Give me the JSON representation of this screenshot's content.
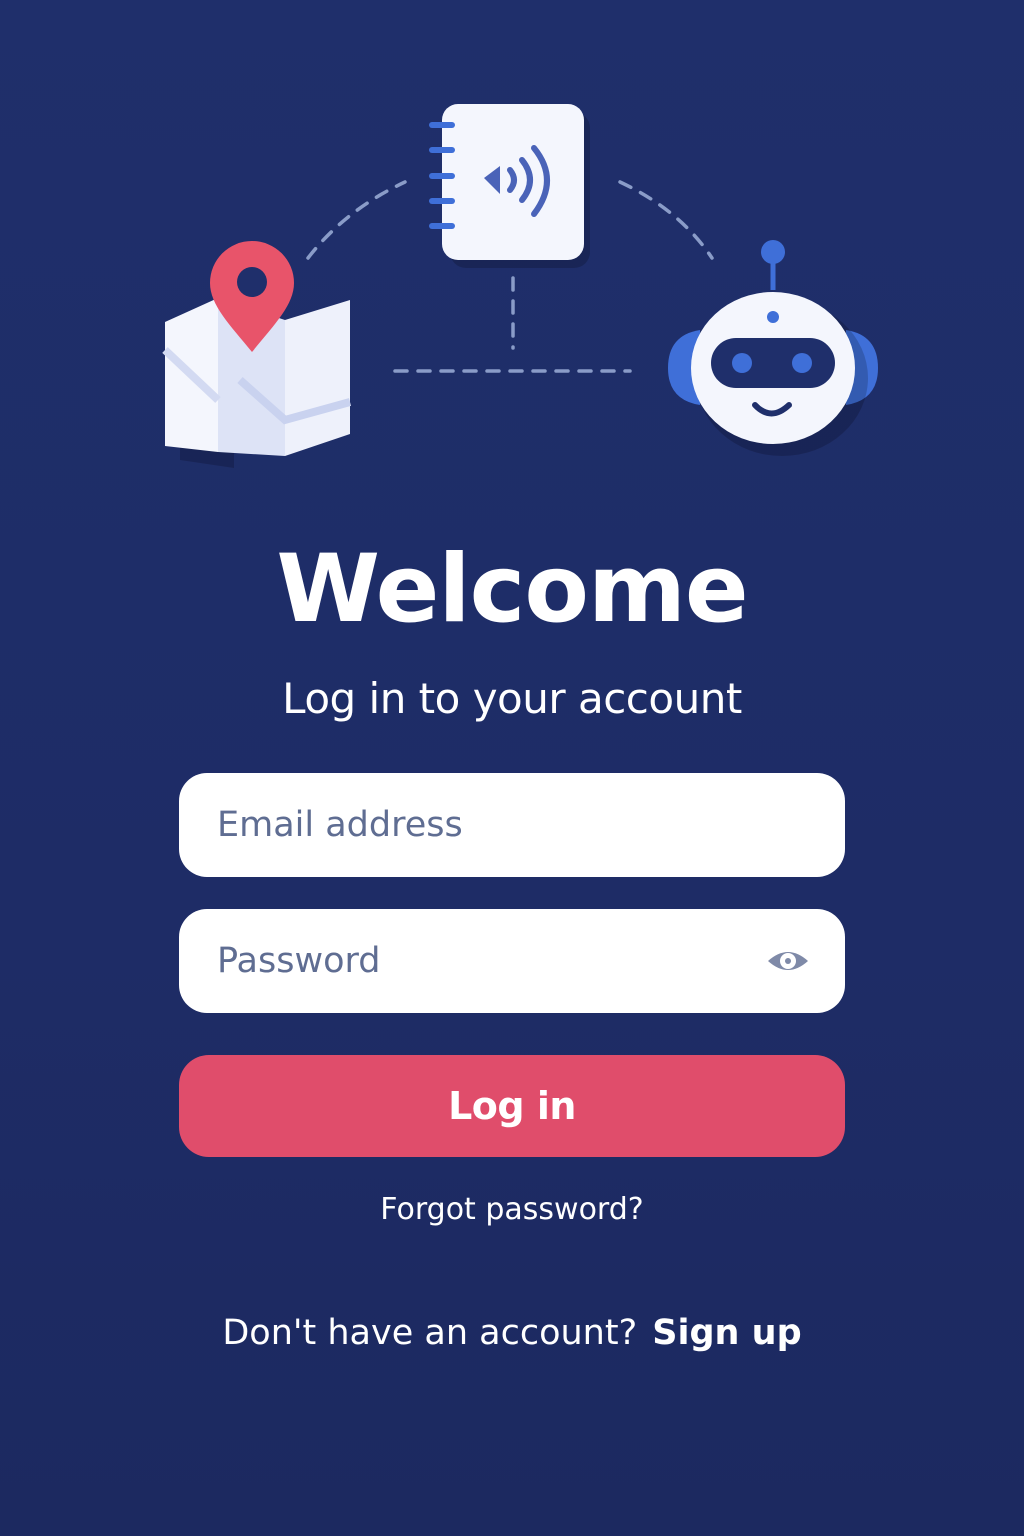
{
  "header": {
    "title": "Welcome",
    "subtitle": "Log in to your account"
  },
  "form": {
    "email_placeholder": "Email address",
    "email_value": "",
    "password_placeholder": "Password",
    "password_value": "",
    "login_label": "Log in",
    "forgot_label": "Forgot password?"
  },
  "footer": {
    "prompt": "Don't have an account?",
    "signup_label": "Sign up"
  },
  "illustration": {
    "icons": [
      "map-pin-icon",
      "audio-notebook-icon",
      "robot-icon"
    ]
  },
  "colors": {
    "background": "#1f2f6b",
    "accent": "#e04d6b",
    "icon_blue": "#3f6fd8"
  }
}
